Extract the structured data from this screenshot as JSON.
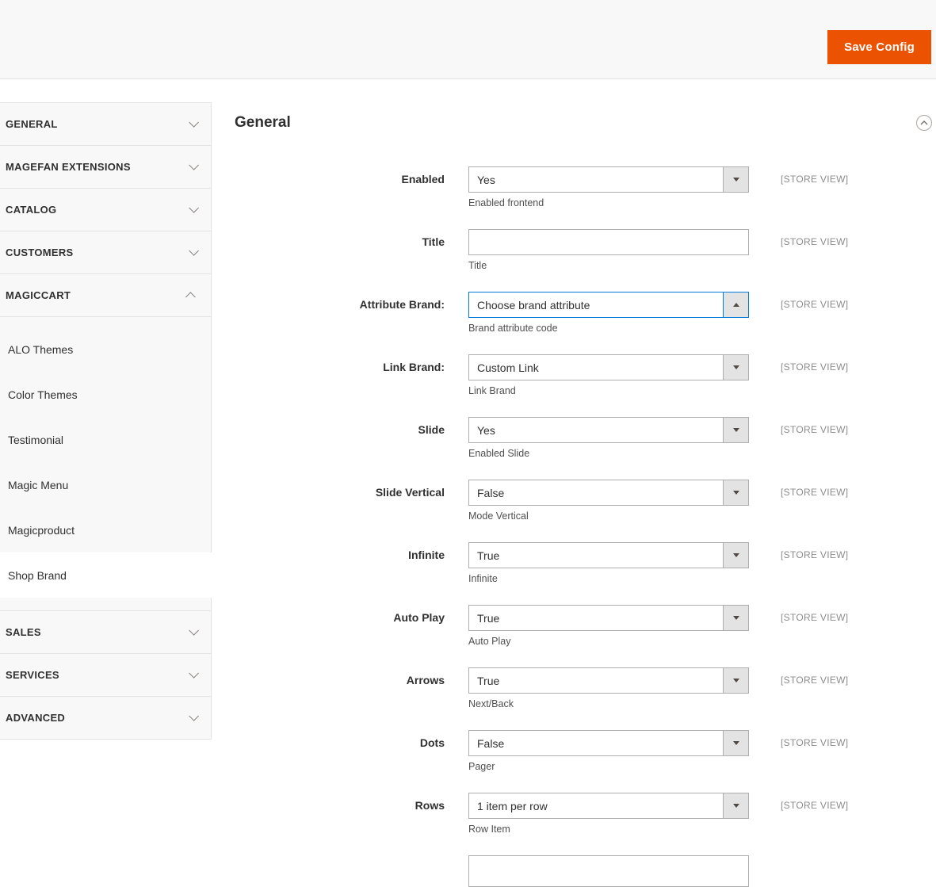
{
  "header": {
    "save_button_label": "Save Config"
  },
  "sidebar": {
    "sections": [
      {
        "label": "GENERAL",
        "expanded": false
      },
      {
        "label": "MAGEFAN EXTENSIONS",
        "expanded": false
      },
      {
        "label": "CATALOG",
        "expanded": false
      },
      {
        "label": "CUSTOMERS",
        "expanded": false
      },
      {
        "label": "MAGICCART",
        "expanded": true
      },
      {
        "label": "SALES",
        "expanded": false
      },
      {
        "label": "SERVICES",
        "expanded": false
      },
      {
        "label": "ADVANCED",
        "expanded": false
      }
    ],
    "magiccart_items": [
      "ALO Themes",
      "Color Themes",
      "Testimonial",
      "Magic Menu",
      "Magicproduct",
      "Shop Brand"
    ],
    "selected_item": "Shop Brand"
  },
  "main": {
    "section_title": "General",
    "scope_label": "[STORE VIEW]",
    "fields": [
      {
        "label": "Enabled",
        "type": "select",
        "value": "Yes",
        "hint": "Enabled frontend"
      },
      {
        "label": "Title",
        "type": "text",
        "value": "",
        "hint": "Title"
      },
      {
        "label": "Attribute Brand:",
        "type": "select",
        "value": "Choose brand attribute",
        "hint": "Brand attribute code",
        "state": "focused-open"
      },
      {
        "label": "Link Brand:",
        "type": "select",
        "value": "Custom Link",
        "hint": "Link Brand"
      },
      {
        "label": "Slide",
        "type": "select",
        "value": "Yes",
        "hint": "Enabled Slide"
      },
      {
        "label": "Slide Vertical",
        "type": "select",
        "value": "False",
        "hint": "Mode Vertical"
      },
      {
        "label": "Infinite",
        "type": "select",
        "value": "True",
        "hint": "Infinite"
      },
      {
        "label": "Auto Play",
        "type": "select",
        "value": "True",
        "hint": "Auto Play"
      },
      {
        "label": "Arrows",
        "type": "select",
        "value": "True",
        "hint": "Next/Back"
      },
      {
        "label": "Dots",
        "type": "select",
        "value": "False",
        "hint": "Pager"
      },
      {
        "label": "Rows",
        "type": "select",
        "value": "1 item per row",
        "hint": "Row Item"
      }
    ]
  },
  "colors": {
    "accent_orange": "#eb5202",
    "focus_blue": "#007bdb",
    "border_gray": "#e3e3e3",
    "input_border": "#adadad"
  }
}
